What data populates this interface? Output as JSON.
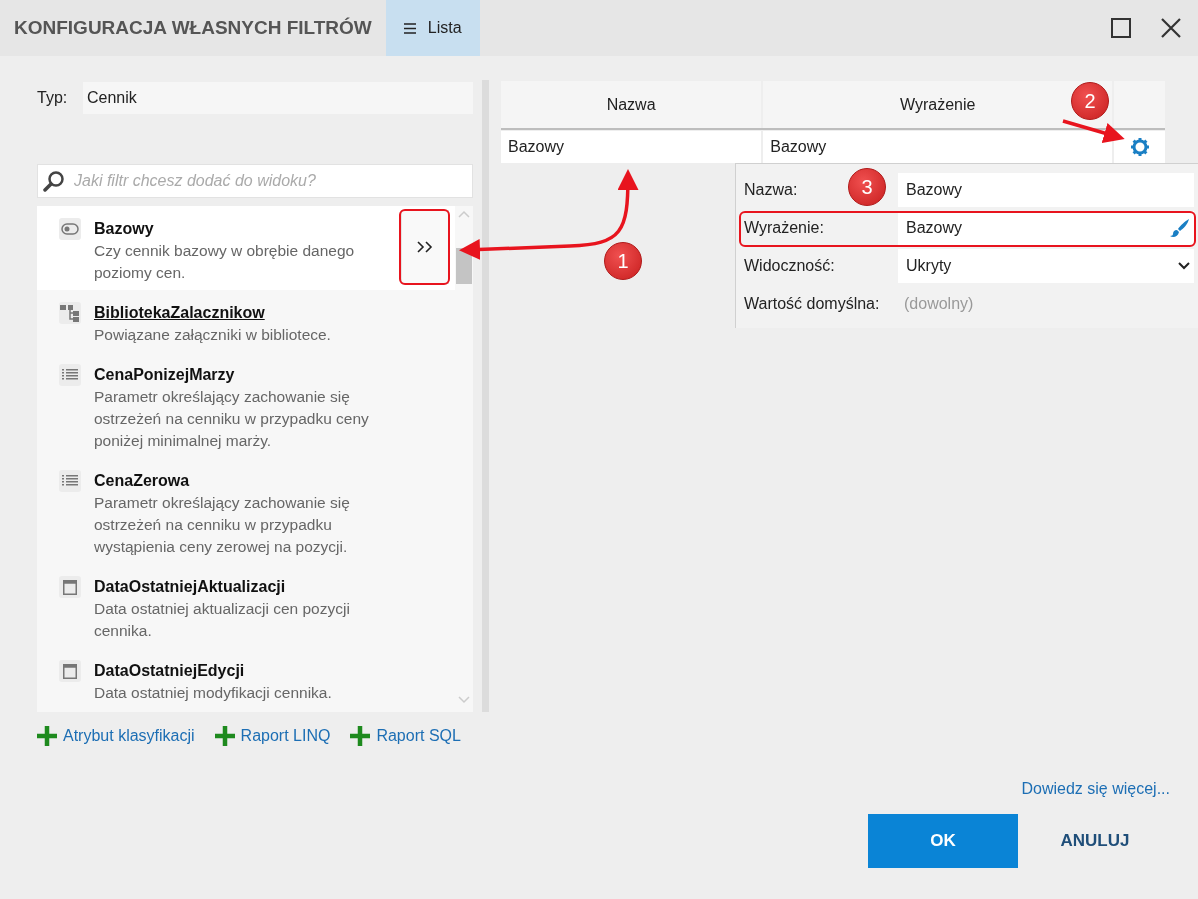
{
  "window": {
    "title": "KONFIGURACJA WŁASNYCH FILTRÓW",
    "view_button": {
      "label": "Lista",
      "active": true
    }
  },
  "type_field": {
    "label": "Typ:",
    "value": "Cennik"
  },
  "search": {
    "placeholder": "Jaki filtr chcesz dodać do widoku?"
  },
  "filters": [
    {
      "kind": "toggle",
      "name": "Bazowy",
      "description": "Czy cennik bazowy w obrębie danego poziomy cen.",
      "selected": true,
      "underlined": false
    },
    {
      "kind": "tree",
      "name": "BibliotekaZalacznikow",
      "description": "Powiązane załączniki w bibliotece.",
      "selected": false,
      "underlined": true
    },
    {
      "kind": "list",
      "name": "CenaPonizejMarzy",
      "description": "Parametr określający zachowanie się ostrzeżeń na cenniku w przypadku ceny poniżej minimalnej marży.",
      "selected": false,
      "underlined": false
    },
    {
      "kind": "list",
      "name": "CenaZerowa",
      "description": "Parametr określający zachowanie się ostrzeżeń na cenniku w przypadku wystąpienia ceny zerowej na pozycji.",
      "selected": false,
      "underlined": false
    },
    {
      "kind": "calendar",
      "name": "DataOstatniejAktualizacji",
      "description": "Data ostatniej aktualizacji cen pozycji cennika.",
      "selected": false,
      "underlined": false
    },
    {
      "kind": "calendar",
      "name": "DataOstatniejEdycji",
      "description": "Data ostatniej modyfikacji cennika.",
      "selected": false,
      "underlined": false
    }
  ],
  "add_links": [
    "Atrybut klasyfikacji",
    "Raport LINQ",
    "Raport SQL"
  ],
  "table": {
    "columns": [
      "Nazwa",
      "Wyrażenie"
    ],
    "rows": [
      {
        "name": "Bazowy",
        "expression": "Bazowy"
      }
    ]
  },
  "properties": [
    {
      "kind": "text",
      "label": "Nazwa:",
      "value": "Bazowy"
    },
    {
      "kind": "expression",
      "label": "Wyrażenie:",
      "value": "Bazowy"
    },
    {
      "kind": "select",
      "label": "Widoczność:",
      "value": "Ukryty"
    },
    {
      "kind": "placeholder",
      "label": "Wartość domyślna:",
      "placeholder": "(dowolny)"
    }
  ],
  "learn_more": "Dowiedz się więcej...",
  "buttons": [
    {
      "kind": "primary",
      "label": "OK"
    },
    {
      "kind": "secondary",
      "label": "ANULUJ"
    }
  ],
  "annotations": [
    {
      "number": "1"
    },
    {
      "number": "2"
    },
    {
      "number": "3"
    }
  ]
}
